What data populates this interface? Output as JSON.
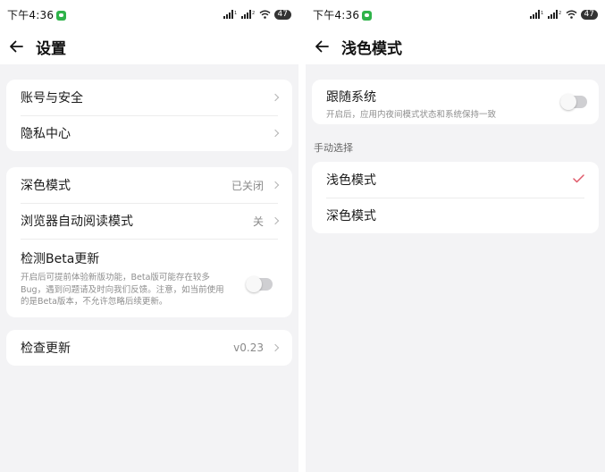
{
  "left": {
    "status": {
      "time": "下午4:36",
      "battery": "47"
    },
    "title": "设置",
    "group1": [
      {
        "label": "账号与安全"
      },
      {
        "label": "隐私中心"
      }
    ],
    "group2": {
      "dark_mode": {
        "label": "深色模式",
        "value": "已关闭"
      },
      "reader_mode": {
        "label": "浏览器自动阅读模式",
        "value": "关"
      },
      "beta": {
        "label": "检测Beta更新",
        "description": "开启后可提前体验新版功能，Beta版可能存在较多Bug，遇到问题请及时向我们反馈。注意，如当前使用的是Beta版本，不允许忽略后续更新。",
        "toggle_on": false
      }
    },
    "update": {
      "label": "检查更新",
      "value": "v0.23"
    }
  },
  "right": {
    "status": {
      "time": "下午4:36",
      "battery": "47"
    },
    "title": "浅色模式",
    "follow_system": {
      "label": "跟随系统",
      "description": "开启后，应用内夜间模式状态和系统保持一致",
      "toggle_on": false
    },
    "manual_label": "手动选择",
    "options": [
      {
        "label": "浅色模式",
        "selected": true
      },
      {
        "label": "深色模式",
        "selected": false
      }
    ]
  },
  "colors": {
    "check": "#e05a6a",
    "background": "#f3f3f5",
    "card": "#ffffff"
  },
  "icons": [
    "back-arrow-icon",
    "chevron-right-icon",
    "checkmark-icon",
    "signal-icon",
    "wifi-icon",
    "wechat-icon"
  ]
}
